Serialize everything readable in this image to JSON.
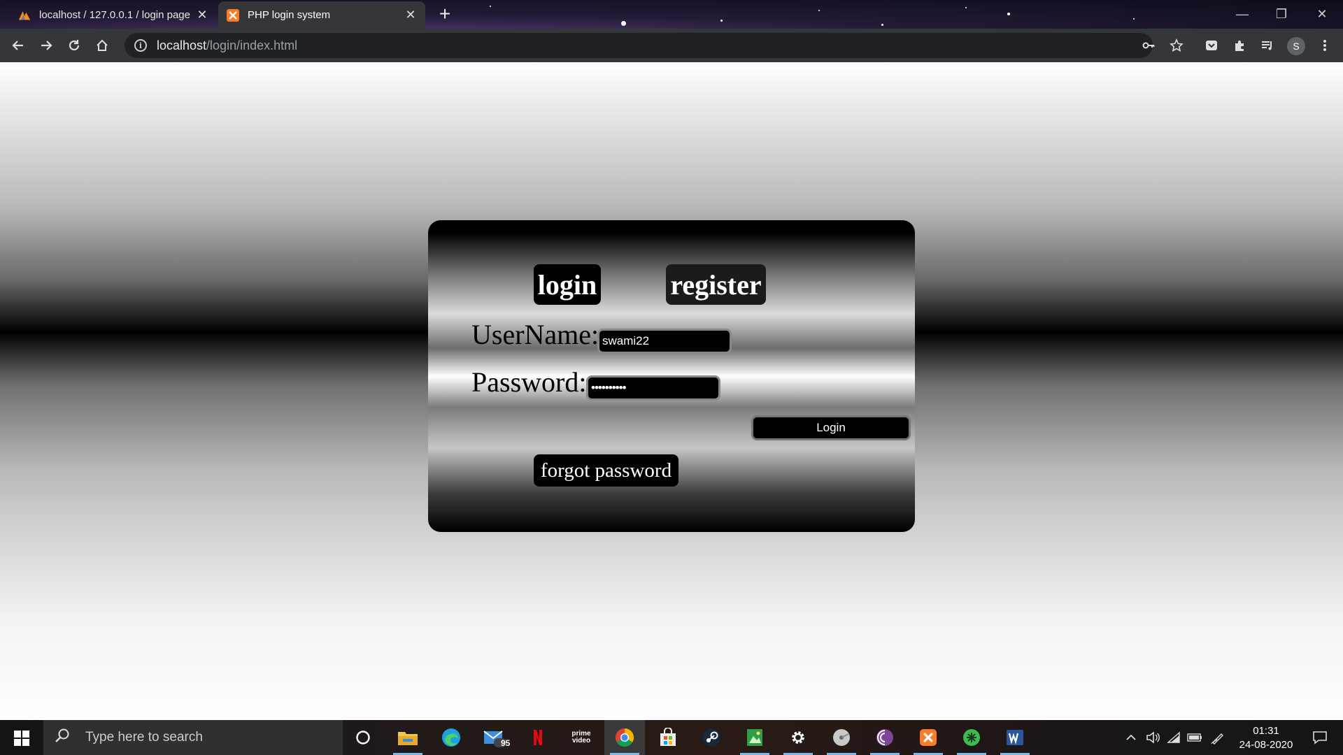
{
  "browser": {
    "tabs": [
      {
        "title": "localhost / 127.0.0.1 / login page",
        "active": false,
        "favicon": "phpmyadmin-icon"
      },
      {
        "title": "PHP login system",
        "active": true,
        "favicon": "xampp-icon"
      }
    ],
    "address": {
      "host": "localhost",
      "path": "/login/index.html"
    },
    "profile_initial": "S"
  },
  "page": {
    "tabs": {
      "login": "login",
      "register": "register"
    },
    "username_label": "UserName:",
    "username_value": "swami22",
    "password_label": "Password:",
    "password_value": "••••••••••",
    "submit_label": "Login",
    "forgot_label": "forgot password"
  },
  "taskbar": {
    "search_placeholder": "Type here to search",
    "mail_badge": "95",
    "time": "01:31",
    "date": "24-08-2020",
    "pinned": [
      "cortana-icon",
      "file-explorer-icon",
      "edge-icon",
      "mail-icon",
      "netflix-icon",
      "prime-video-icon",
      "chrome-icon",
      "store-icon",
      "steam-icon",
      "photos-icon",
      "settings-icon",
      "disk-icon",
      "tor-icon",
      "xampp-icon",
      "app-icon",
      "word-icon"
    ],
    "prime_label": "prime video"
  }
}
